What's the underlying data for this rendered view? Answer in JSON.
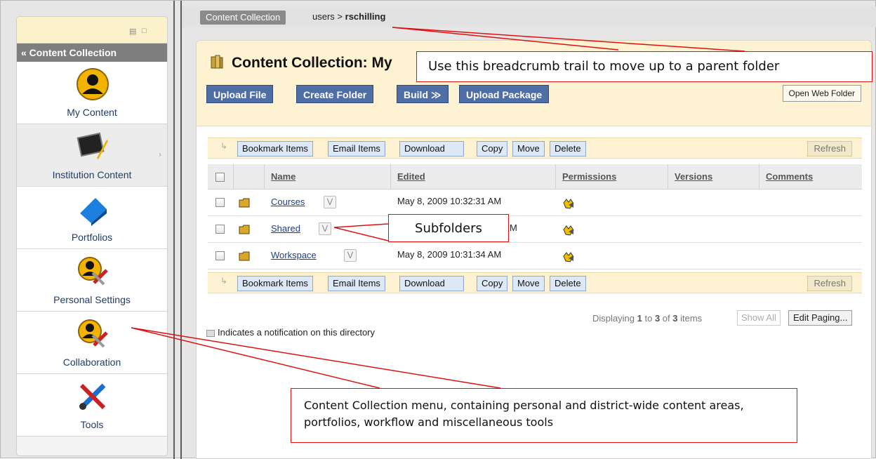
{
  "sidebar": {
    "header": "« Content Collection",
    "items": [
      {
        "label": "My Content"
      },
      {
        "label": "Institution Content"
      },
      {
        "label": "Portfolios"
      },
      {
        "label": "Personal Settings"
      },
      {
        "label": "Collaboration"
      },
      {
        "label": "Tools"
      }
    ]
  },
  "breadcrumb": {
    "root": "Content Collection",
    "path_prefix": "users",
    "separator": ">",
    "current": "rschilling"
  },
  "page": {
    "title": "Content Collection: My",
    "buttons": [
      "Upload File",
      "Create Folder",
      "Build ≫",
      "Upload Package"
    ],
    "open_web_folder": "Open Web Folder"
  },
  "action_bar": {
    "buttons": [
      "Bookmark Items",
      "Email Items",
      "Download",
      "Copy",
      "Move",
      "Delete"
    ],
    "refresh": "Refresh"
  },
  "table": {
    "headers": [
      "Name",
      "Edited",
      "Permissions",
      "Versions",
      "Comments"
    ],
    "rows": [
      {
        "name": "Courses",
        "edited": "May 8, 2009 10:32:31 AM"
      },
      {
        "name": "Shared",
        "edited": "M"
      },
      {
        "name": "Workspace",
        "edited": "May 8, 2009 10:31:34 AM"
      }
    ]
  },
  "paging": {
    "prefix": "Displaying",
    "from": "1",
    "to_word": "to",
    "to": "3",
    "of_word": "of",
    "total": "3",
    "suffix": "items",
    "show_all": "Show All",
    "edit_paging": "Edit Paging..."
  },
  "notification_note": "Indicates a notification on this directory",
  "callouts": {
    "breadcrumb": "Use this breadcrumb trail to move up to a parent folder",
    "subfolders": "Subfolders",
    "menu": "Content Collection menu, containing personal and district-wide content areas, portfolios, workflow and miscellaneous tools"
  },
  "colors": {
    "accent_button": "#4f6ea6",
    "header_bg": "#fdf3d2",
    "callout_border": "#dd1111"
  }
}
